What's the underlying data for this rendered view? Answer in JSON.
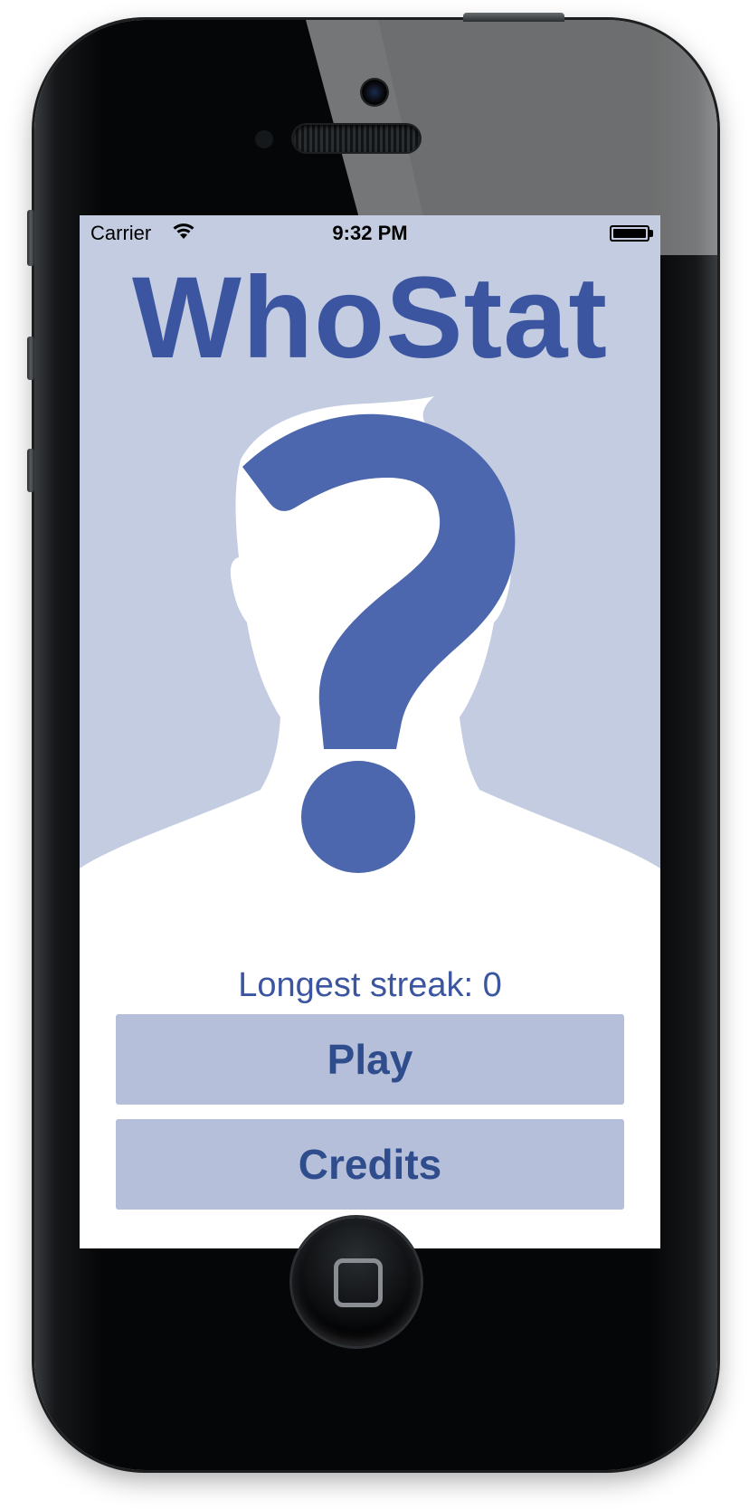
{
  "status_bar": {
    "carrier": "Carrier",
    "time": "9:32 PM",
    "wifi_icon": "wifi-icon",
    "battery_icon": "battery-icon",
    "battery_level": 1.0
  },
  "app": {
    "title": "WhoStat",
    "hero_image": "question-mark-silhouette-icon",
    "streak_text": "Longest streak: 0",
    "play_label": "Play",
    "credits_label": "Credits"
  },
  "colors": {
    "accent": "#3c55a0",
    "hero_background": "#c3cce0",
    "button_background": "#b6bfd9",
    "question_mark": "#4c67ad"
  }
}
